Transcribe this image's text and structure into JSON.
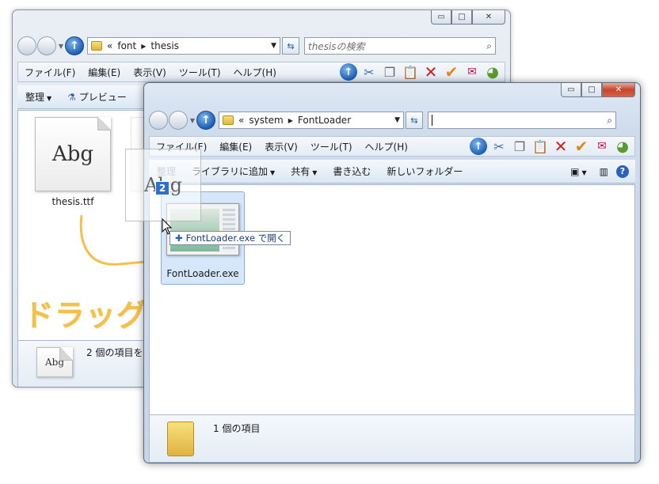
{
  "back_window": {
    "caption": {
      "minimize": "▭",
      "maximize": "□",
      "close": "✕"
    },
    "breadcrumb": [
      "«",
      "font",
      "thesis"
    ],
    "search_placeholder": "thesisの検索",
    "menu": [
      "ファイル(F)",
      "編集(E)",
      "表示(V)",
      "ツール(T)",
      "ヘルプ(H)"
    ],
    "commands": [
      "整理",
      "プレビュー"
    ],
    "file": {
      "name": "thesis.ttf",
      "preview": "Abg"
    },
    "details_text": "2 個の項目を",
    "details_preview": "Abg"
  },
  "front_window": {
    "caption": {
      "minimize": "▭",
      "maximize": "□",
      "close": "✕"
    },
    "breadcrumb": [
      "«",
      "system",
      "FontLoader"
    ],
    "search_value": "",
    "menu": [
      "ファイル(F)",
      "編集(E)",
      "表示(V)",
      "ツール(T)",
      "ヘルプ(H)"
    ],
    "commands": [
      "整理",
      "ライブラリに追加",
      "共有",
      "書き込む",
      "新しいフォルダー"
    ],
    "file": {
      "name": "FontLoader.exe"
    },
    "details_text": "1 個の項目"
  },
  "drag": {
    "preview": "Abg",
    "badge": "2",
    "tooltip": "FontLoader.exe で開く"
  },
  "headline": "ドラッグ＆ドロップ！",
  "colors": {
    "headline": "#f5c04a",
    "selection": "#cfe3fa",
    "accent": "#1d5fb4"
  }
}
